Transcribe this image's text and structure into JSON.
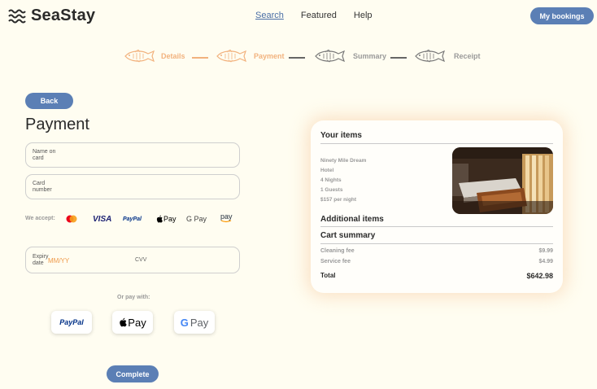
{
  "brand": {
    "name": "SeaStay"
  },
  "nav": {
    "items": [
      "Search",
      "Featured",
      "Help"
    ]
  },
  "header": {
    "my_bookings": "My bookings"
  },
  "steps": [
    {
      "label": "Details",
      "state": "done"
    },
    {
      "label": "Payment",
      "state": "done"
    },
    {
      "label": "Summary",
      "state": "todo"
    },
    {
      "label": "Receipt",
      "state": "todo"
    }
  ],
  "payment": {
    "back": "Back",
    "title": "Payment",
    "name_label": "Name on card",
    "card_label": "Card number",
    "we_accept": "We accept:",
    "accepted": [
      "mastercard",
      "VISA",
      "PayPal",
      "Pay",
      "G Pay",
      "pay"
    ],
    "expiry_label": "Expiry date",
    "expiry_placeholder": "MM/YY",
    "cvv_label": "CVV",
    "or_pay_with": "Or pay with:",
    "alt_buttons": [
      "PayPal",
      "Pay",
      "Pay"
    ],
    "complete": "Complete"
  },
  "cart": {
    "your_items": "Your items",
    "item": {
      "name": "Ninety Mile Dream",
      "type": "Hotel",
      "nights": "4 Nights",
      "guests": "1 Guests",
      "price": "$157 per night"
    },
    "additional_items": "Additional items",
    "cart_summary": "Cart summary",
    "fees": [
      {
        "label": "Cleaning fee",
        "amount": "$9.99"
      },
      {
        "label": "Service fee",
        "amount": "$4.99"
      }
    ],
    "total_label": "Total",
    "total_amount": "$642.98"
  },
  "colors": {
    "accent": "#5b7fb5",
    "step_done": "#f2b27e",
    "step_todo": "#9a9a9a",
    "background": "#fffdf1"
  }
}
